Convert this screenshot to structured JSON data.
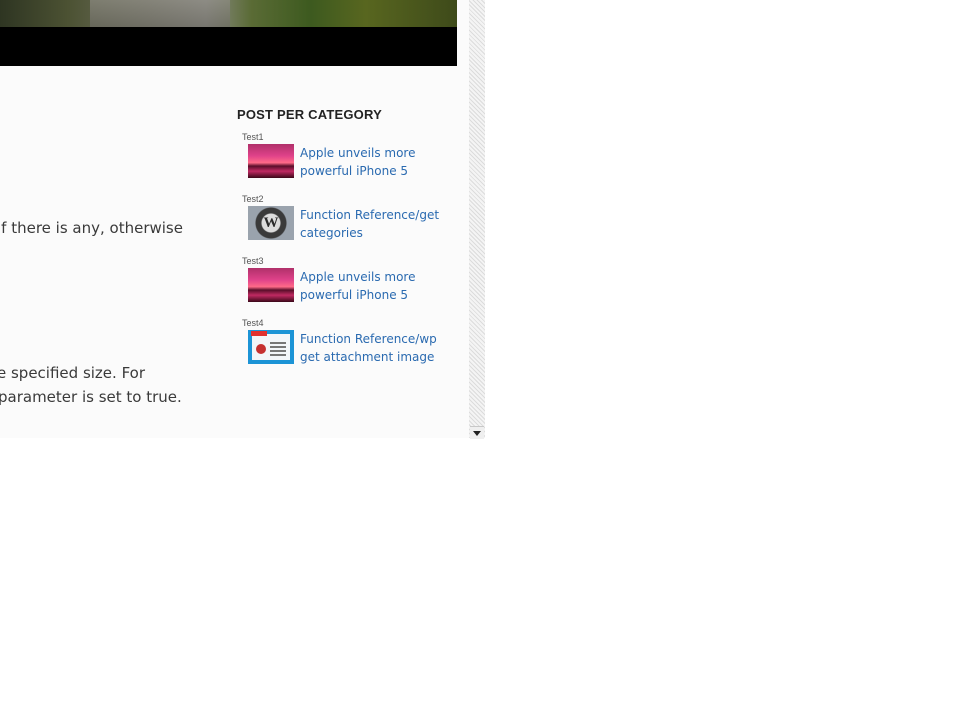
{
  "article": {
    "line1": "if there is any, otherwise",
    "line2": "e specified size. For",
    "line3": "parameter is set to true."
  },
  "widget": {
    "title": "POST PER CATEGORY",
    "categories": [
      {
        "name": "Test1",
        "post": "Apple unveils more powerful iPhone 5",
        "thumb": "sunset-thumbnail"
      },
      {
        "name": "Test2",
        "post": "Function Reference/get categories",
        "thumb": "wordpress-logo-thumbnail"
      },
      {
        "name": "Test3",
        "post": "Apple unveils more powerful iPhone 5",
        "thumb": "sunset-thumbnail"
      },
      {
        "name": "Test4",
        "post": "Function Reference/wp get attachment image",
        "thumb": "document-thumbnail"
      }
    ]
  },
  "wp_logo_letter": "W",
  "colors": {
    "link": "#2a6ab0",
    "header_bar": "#000000"
  },
  "icons": {
    "scroll_down": "chevron-down-icon"
  }
}
